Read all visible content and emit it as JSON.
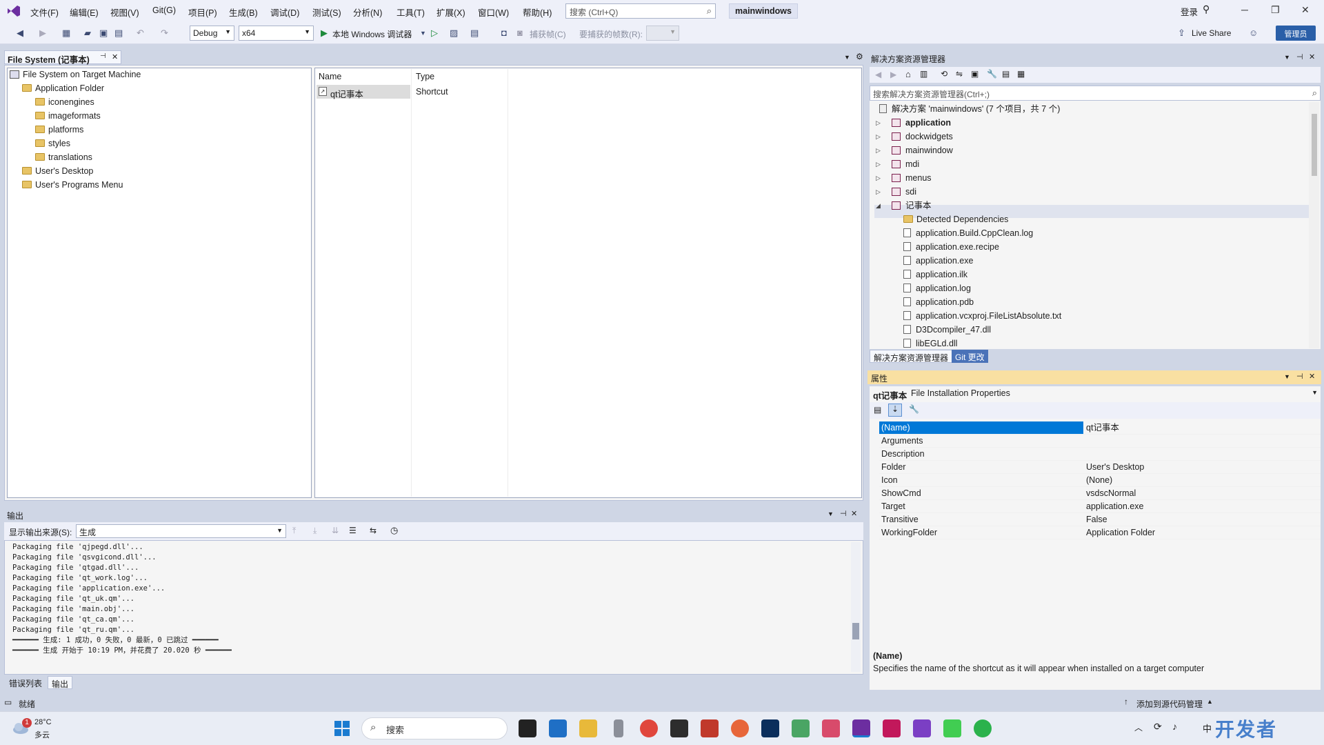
{
  "menu": [
    "文件(F)",
    "编辑(E)",
    "视图(V)",
    "Git(G)",
    "项目(P)",
    "生成(B)",
    "调试(D)",
    "测试(S)",
    "分析(N)",
    "工具(T)",
    "扩展(X)",
    "窗口(W)",
    "帮助(H)"
  ],
  "search_placeholder": "搜索 (Ctrl+Q)",
  "solution_name": "mainwindows",
  "login": "登录",
  "toolbar": {
    "config": "Debug",
    "platform": "x64",
    "run_label": "本地 Windows 调试器",
    "capture": "捕获帧(C)",
    "capture_count": "要捕获的帧数(R):",
    "live_share": "Live Share",
    "admin": "管理员"
  },
  "doc_tab": "File System (记事本)",
  "fs_tree": {
    "root": "File System on Target Machine",
    "app_folder": "Application Folder",
    "children": [
      "iconengines",
      "imageformats",
      "platforms",
      "styles",
      "translations"
    ],
    "desktop": "User's Desktop",
    "programs": "User's Programs Menu"
  },
  "list": {
    "col_name": "Name",
    "col_type": "Type",
    "row_name": "qt记事本",
    "row_type": "Shortcut"
  },
  "output": {
    "title": "输出",
    "source_label": "显示输出来源(S):",
    "source_value": "生成",
    "lines": [
      "Packaging file 'qjpegd.dll'...",
      "Packaging file 'qsvgicond.dll'...",
      "Packaging file 'qtgad.dll'...",
      "Packaging file 'qt_work.log'...",
      "Packaging file 'application.exe'...",
      "Packaging file 'qt_uk.qm'...",
      "Packaging file 'main.obj'...",
      "Packaging file 'qt_ca.qm'...",
      "Packaging file 'qt_ru.qm'...",
      "━━━━━━ 生成: 1 成功，0 失败，0 最新，0 已跳过 ━━━━━━",
      "━━━━━━ 生成 开始于 10:19 PM，并花费了 20.020 秒 ━━━━━━"
    ],
    "tab_errors": "错误列表",
    "tab_output": "输出"
  },
  "solution_explorer": {
    "title": "解决方案资源管理器",
    "search": "搜索解决方案资源管理器(Ctrl+;)",
    "solution": "解决方案 'mainwindows' (7 个项目，共 7 个)",
    "projects": [
      "application",
      "dockwidgets",
      "mainwindow",
      "mdi",
      "menus",
      "sdi",
      "记事本"
    ],
    "files": [
      "Detected Dependencies",
      "application.Build.CppClean.log",
      "application.exe.recipe",
      "application.exe",
      "application.ilk",
      "application.log",
      "application.pdb",
      "application.vcxproj.FileListAbsolute.txt",
      "D3Dcompiler_47.dll",
      "libEGLd.dll"
    ],
    "tab_se": "解决方案资源管理器",
    "tab_git": "Git 更改"
  },
  "properties": {
    "title": "属性",
    "object": "qt记事本",
    "object_type": "File Installation Properties",
    "rows": [
      {
        "k": "(Name)",
        "v": "qt记事本"
      },
      {
        "k": "Arguments",
        "v": ""
      },
      {
        "k": "Description",
        "v": ""
      },
      {
        "k": "Folder",
        "v": "User's Desktop"
      },
      {
        "k": "Icon",
        "v": "(None)"
      },
      {
        "k": "ShowCmd",
        "v": "vsdscNormal"
      },
      {
        "k": "Target",
        "v": "application.exe"
      },
      {
        "k": "Transitive",
        "v": "False"
      },
      {
        "k": "WorkingFolder",
        "v": "Application Folder"
      }
    ],
    "desc_title": "(Name)",
    "desc_text": "Specifies the name of the shortcut as it will appear when installed on a target computer"
  },
  "status": {
    "ready": "就绪",
    "source_control": "添加到源代码管理"
  },
  "taskbar": {
    "temp": "28°C",
    "weather": "多云",
    "badge": "1",
    "search": "搜索",
    "watermark": "开发者 DevZe.CoM",
    "ime": "中"
  },
  "colors": {
    "accent": "#1a7bd0",
    "selection": "#0078d7",
    "vs_purple": "#6c2ea0",
    "properties_title": "#f9e0a2"
  }
}
